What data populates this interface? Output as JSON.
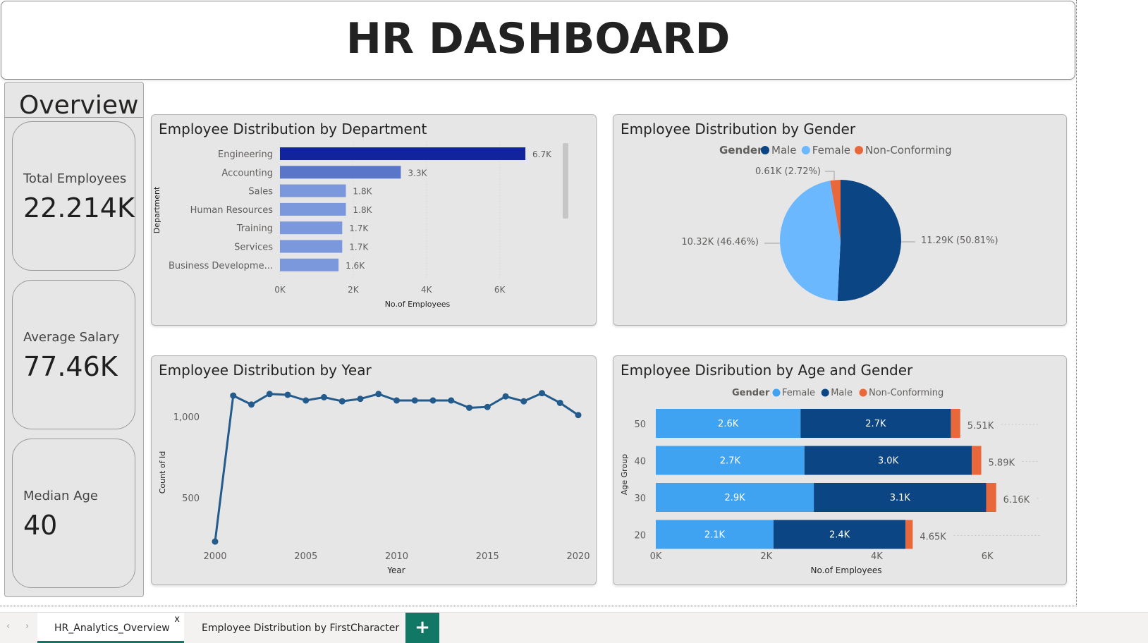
{
  "header": {
    "title": "HR DASHBOARD"
  },
  "overview": {
    "title": "Overview",
    "kpis": [
      {
        "label": "Total Employees",
        "value": "22.214K"
      },
      {
        "label": "Average Salary",
        "value": "77.46K"
      },
      {
        "label": "Median Age",
        "value": "40"
      }
    ]
  },
  "panels": {
    "department": {
      "title": "Employee Distribution by Department"
    },
    "gender": {
      "title": "Employee Distribution by Gender"
    },
    "year": {
      "title": "Employee Distribution by Year"
    },
    "age_gender": {
      "title": "Employee Disribution by Age and Gender"
    }
  },
  "chart_data": [
    {
      "type": "bar",
      "orientation": "horizontal",
      "title": "Employee Distribution by Department",
      "xlabel": "No.of Employees",
      "ylabel": "Department",
      "categories": [
        "Engineering",
        "Accounting",
        "Sales",
        "Human Resources",
        "Training",
        "Services",
        "Business Developme..."
      ],
      "values": [
        6700,
        3300,
        1800,
        1800,
        1700,
        1700,
        1600
      ],
      "data_labels": [
        "6.7K",
        "3.3K",
        "1.8K",
        "1.8K",
        "1.7K",
        "1.7K",
        "1.6K"
      ],
      "xticks": [
        0,
        2000,
        4000,
        6000
      ],
      "xtick_labels": [
        "0K",
        "2K",
        "4K",
        "6K"
      ],
      "xlim": [
        0,
        7700
      ],
      "colors": [
        "#12239e",
        "#5a76c9",
        "#7b98dc",
        "#7b98dc",
        "#7b98dc",
        "#7b98dc",
        "#7b98dc"
      ],
      "grid": true
    },
    {
      "type": "pie",
      "title": "Employee Distribution by Gender",
      "legend_title": "Gender",
      "legend_position": "top",
      "slices": [
        {
          "name": "Male",
          "value": 11290,
          "label": "11.29K (50.81%)",
          "color": "#0b4583"
        },
        {
          "name": "Female",
          "value": 10320,
          "label": "10.32K (46.46%)",
          "color": "#6cb8ff"
        },
        {
          "name": "Non-Conforming",
          "value": 610,
          "label": "0.61K (2.72%)",
          "color": "#e8683c"
        }
      ]
    },
    {
      "type": "line",
      "title": "Employee Distribution by Year",
      "xlabel": "Year",
      "ylabel": "Count of Id",
      "x": [
        2000,
        2001,
        2002,
        2003,
        2004,
        2005,
        2006,
        2007,
        2008,
        2009,
        2010,
        2011,
        2012,
        2013,
        2014,
        2015,
        2016,
        2017,
        2018,
        2019,
        2020
      ],
      "y": [
        230,
        1130,
        1075,
        1140,
        1135,
        1100,
        1120,
        1095,
        1110,
        1140,
        1100,
        1100,
        1100,
        1100,
        1055,
        1060,
        1125,
        1095,
        1145,
        1085,
        1010
      ],
      "xticks": [
        2000,
        2005,
        2010,
        2015,
        2020
      ],
      "xtick_labels": [
        "2000",
        "2005",
        "2010",
        "2015",
        "2020"
      ],
      "yticks": [
        500,
        1000
      ],
      "ytick_labels": [
        "500",
        "1,000"
      ],
      "xlim": [
        2000,
        2020
      ],
      "ylim": [
        200,
        1200
      ],
      "color": "#235b8c"
    },
    {
      "type": "bar",
      "orientation": "horizontal",
      "stacked": true,
      "title": "Employee Disribution by Age and Gender",
      "legend_title": "Gender",
      "legend_position": "top",
      "xlabel": "No.of Employees",
      "ylabel": "Age Group",
      "categories": [
        "50",
        "40",
        "30",
        "20"
      ],
      "series": [
        {
          "name": "Female",
          "values": [
            2620,
            2690,
            2860,
            2130
          ],
          "labels": [
            "2.6K",
            "2.7K",
            "2.9K",
            "2.1K"
          ],
          "color": "#3fa3f2"
        },
        {
          "name": "Male",
          "values": [
            2720,
            3030,
            3120,
            2390
          ],
          "labels": [
            "2.7K",
            "3.0K",
            "3.1K",
            "2.4K"
          ],
          "color": "#0b4583"
        },
        {
          "name": "Non-Conforming",
          "values": [
            170,
            170,
            180,
            130
          ],
          "labels": [
            "",
            "",
            "",
            ""
          ],
          "color": "#e8683c"
        }
      ],
      "totals": [
        "5.51K",
        "5.89K",
        "6.16K",
        "4.65K"
      ],
      "xticks": [
        0,
        2000,
        4000,
        6000
      ],
      "xtick_labels": [
        "0K",
        "2K",
        "4K",
        "6K"
      ],
      "xlim": [
        0,
        6700
      ]
    }
  ],
  "tabs": {
    "items": [
      {
        "label": "HR_Analytics_Overview",
        "close": "x"
      },
      {
        "label": "Employee Distribution by FirstCharacter"
      }
    ],
    "add_label": "+",
    "prev_arrow": "‹",
    "next_arrow": "›"
  }
}
